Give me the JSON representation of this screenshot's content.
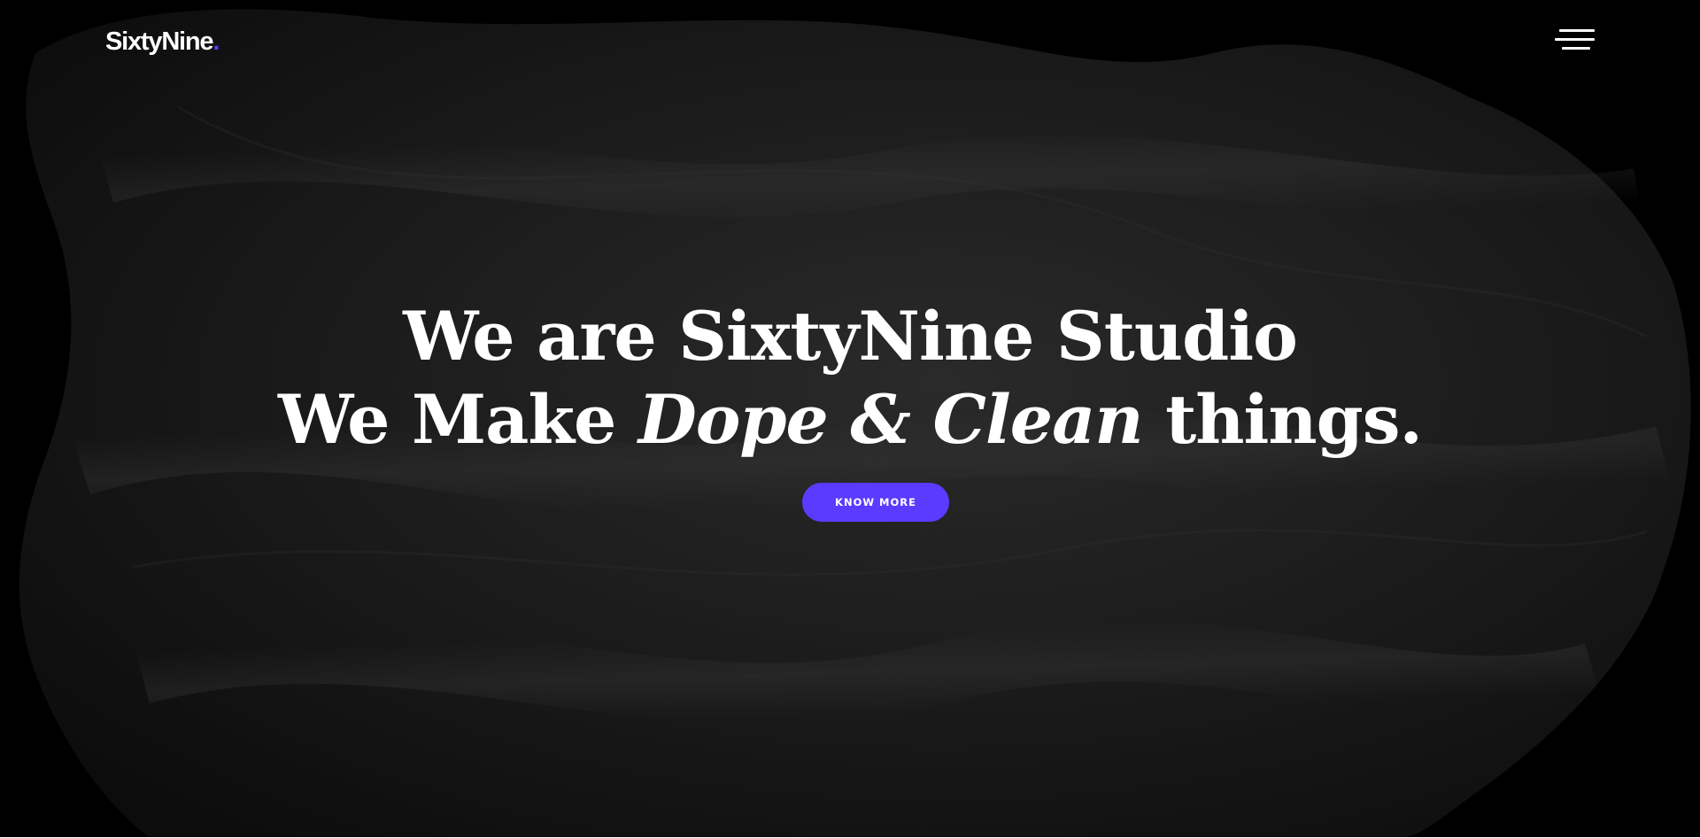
{
  "header": {
    "logo_text": "SixtyNine",
    "logo_dot": ".",
    "menu_icon": "hamburger-menu-icon"
  },
  "hero": {
    "headline_line1": "We are SixtyNine Studio",
    "headline_line2_start": "We Make ",
    "headline_line2_italic": "Dope & Clean",
    "headline_line2_end": " things.",
    "cta_label": "KNOW MORE"
  },
  "colors": {
    "background": "#000000",
    "accent": "#5b3bff",
    "text": "#ffffff"
  }
}
